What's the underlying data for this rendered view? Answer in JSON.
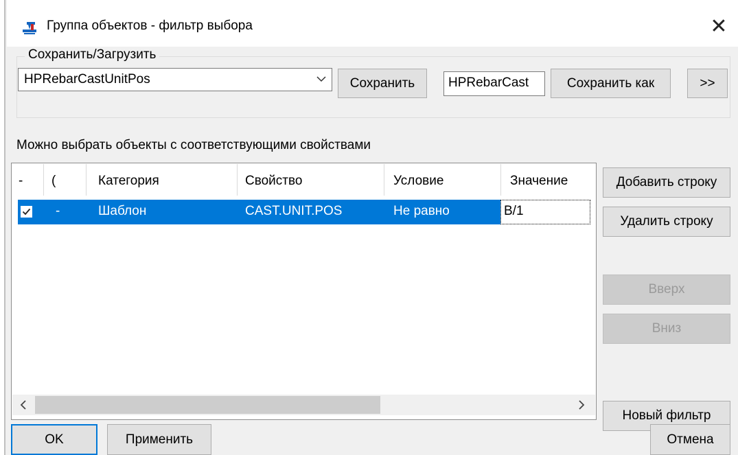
{
  "window": {
    "title": "Группа объектов - фильтр выбора",
    "close_glyph": "✕"
  },
  "save_load": {
    "group_label": "Сохранить/Загрузить",
    "selected_filter": "HPRebarCastUnitPos",
    "save_button": "Сохранить",
    "save_as_name": "HPRebarCast",
    "save_as_button": "Сохранить как",
    "more_button": ">>"
  },
  "filter_table": {
    "caption": "Можно выбрать объекты с соответствующими свойствами",
    "columns": [
      "-",
      "(",
      "Категория",
      "Свойство",
      "Условие",
      "Значение"
    ],
    "rows": [
      {
        "checked": true,
        "paren": "-",
        "category": "Шаблон",
        "property": "CAST.UNIT.POS",
        "condition": "Не равно",
        "value": "B/1"
      }
    ]
  },
  "side_buttons": {
    "add_row": "Добавить строку",
    "delete_row": "Удалить строку",
    "up": "Вверх",
    "down": "Вниз",
    "new_filter": "Новый фильтр"
  },
  "footer": {
    "ok": "OK",
    "apply": "Применить",
    "cancel": "Отмена"
  },
  "colors": {
    "selection": "#0078d7",
    "button_face": "#e1e1e1",
    "disabled_face": "#cccccc"
  }
}
